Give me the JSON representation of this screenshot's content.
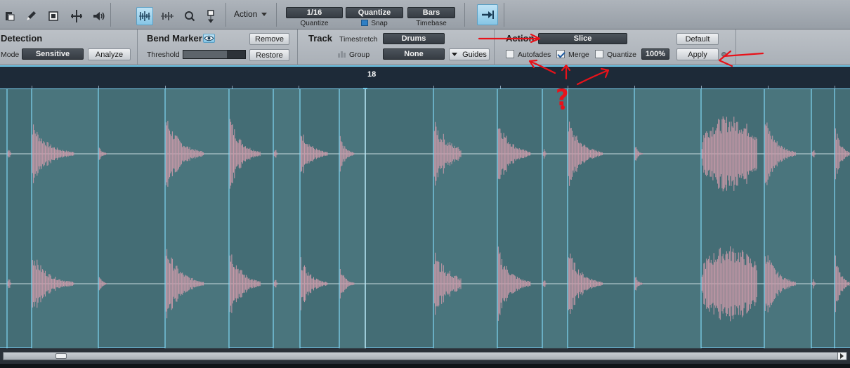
{
  "toolbar": {
    "tools": [
      "arrange-tool-icon",
      "pencil-icon",
      "eraser-icon",
      "split-tool-icon",
      "speaker-icon"
    ],
    "audio_bend_tools": [
      "bend-tool-icon",
      "bend-range-icon",
      "zoom-tool-icon",
      "listen-tool-icon"
    ],
    "action_label": "Action",
    "quantize_value": "1/16",
    "quantize_caption": "Quantize",
    "quantize_button": "Quantize",
    "snap_caption": "Snap",
    "timebase_value": "Bars",
    "timebase_caption": "Timebase",
    "follow_icon": "follow-arrow-icon"
  },
  "detection": {
    "title": "Detection",
    "mode_label": "Mode",
    "mode_value": "Sensitive",
    "analyze_label": "Analyze"
  },
  "bend_marker": {
    "title": "Bend Marker",
    "eye_icon": "eye-icon",
    "remove_label": "Remove",
    "threshold_label": "Threshold",
    "threshold_level": 0.7,
    "restore_label": "Restore"
  },
  "track": {
    "title": "Track",
    "timestretch_label": "Timestretch",
    "timestretch_value": "Drums",
    "group_label": "Group",
    "group_value": "None",
    "guides_label": "Guides"
  },
  "action": {
    "title": "Action",
    "action_value": "Slice",
    "default_label": "Default",
    "autofades_label": "Autofades",
    "autofades_checked": false,
    "merge_label": "Merge",
    "merge_checked": true,
    "quantize_label": "Quantize",
    "quantize_checked": false,
    "strength_value": "100%",
    "apply_label": "Apply"
  },
  "ruler": {
    "bar_number": "18"
  },
  "annotations": {
    "question_mark": "?",
    "color": "#e8121a"
  }
}
